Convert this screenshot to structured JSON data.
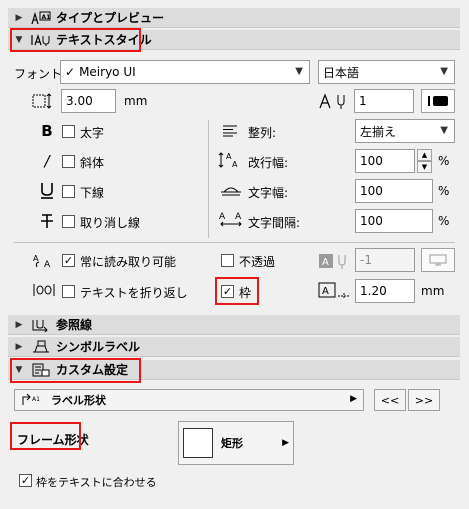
{
  "sections": {
    "type_preview": "タイプとプレビュー",
    "text_style": "テキストスタイル",
    "leader": "参照線",
    "symbol_label": "シンボルラベル",
    "custom_settings": "カスタム設定"
  },
  "font": {
    "label": "フォント:",
    "value": "Meiryo UI",
    "language": "日本語"
  },
  "size": {
    "value": "3.00",
    "unit": "mm",
    "pen_value": "1"
  },
  "styles": {
    "bold": "太字",
    "italic": "斜体",
    "underline": "下線",
    "strikethrough": "取り消し線"
  },
  "paragraph": {
    "align_label": "整列:",
    "align_value": "左揃え",
    "line_spacing_label": "改行幅:",
    "line_spacing_value": "100",
    "width_label": "文字幅:",
    "width_value": "100",
    "spacing_label": "文字間隔:",
    "spacing_value": "100",
    "percent": "%"
  },
  "options": {
    "always_readable": "常に読み取り可能",
    "opaque": "不透過",
    "opaque_value": "-1",
    "wrap_text": "テキストを折り返し",
    "frame": "枠",
    "frame_offset_value": "1.20",
    "frame_offset_unit": "mm"
  },
  "custom": {
    "label_shape": "ラベル形状",
    "prev_button": "<<",
    "next_button": ">>",
    "frame_shape_title": "フレーム形状",
    "frame_shape_value": "矩形",
    "fit_frame_to_text": "枠をテキストに合わせる"
  },
  "colors": {
    "highlight": "#e81818",
    "section_bg": "#dcdcdc",
    "panel_bg": "#f0f0f0"
  }
}
